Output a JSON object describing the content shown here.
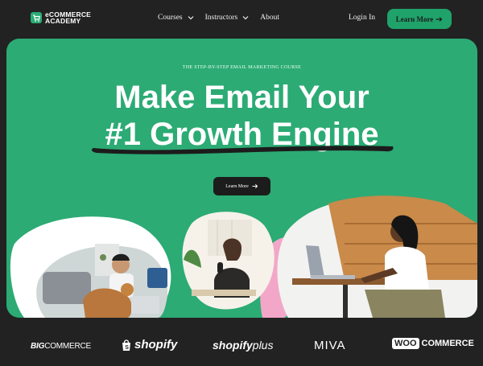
{
  "nav": {
    "logo_line1": "eCOMMERCE",
    "logo_line2": "ACADEMY",
    "links": [
      "Courses",
      "Instructors",
      "About"
    ],
    "login": "Login In",
    "cta": "Learn More"
  },
  "hero": {
    "eyebrow": "THE STEP-BY-STEP EMAIL MARKETING COURSE",
    "headline_line1": "Make Email Your",
    "headline_line2": "#1 Growth Engine",
    "button": "Learn More"
  },
  "brands": {
    "bigcommerce_big": "BIG",
    "bigcommerce_rest": "COMMERCE",
    "shopify": "shopify",
    "shopifyplus_a": "shopify",
    "shopifyplus_b": "plus",
    "miva": "MIVA",
    "woo": "WOO",
    "woocommerce": "COMMERCE"
  },
  "colors": {
    "background": "#222222",
    "hero_green": "#2cab74",
    "accent_green": "#1fa36b",
    "pink_blob": "#f2a7c8"
  },
  "icons": [
    "cart-icon",
    "chevron-down-icon",
    "arrow-right-icon",
    "shopify-bag-icon"
  ]
}
